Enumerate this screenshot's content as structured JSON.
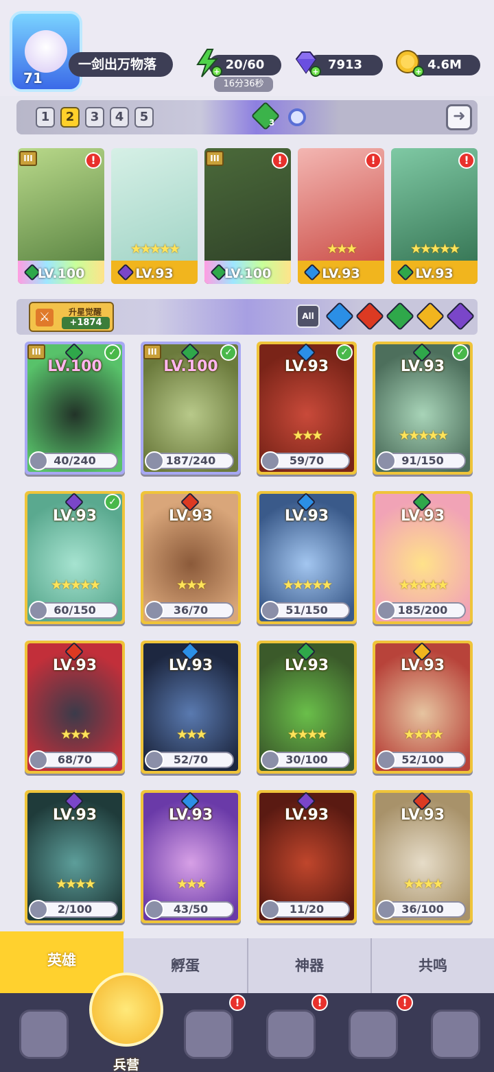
{
  "player": {
    "level": "71",
    "name": "一剑出万物落"
  },
  "resources": {
    "energy": "20/60",
    "energy_timer": "16分36秒",
    "diamonds": "7913",
    "gold": "4.6M"
  },
  "team_tabs": [
    "1",
    "2",
    "3",
    "4",
    "5"
  ],
  "active_team": "2",
  "green_gem_count": "3",
  "team": [
    {
      "level": "LV.100",
      "stars": "",
      "element": "green",
      "bar": "rainbow",
      "tier": "III",
      "alert": "!"
    },
    {
      "level": "LV.93",
      "stars": "★★★★★",
      "element": "purple",
      "bar": "gold",
      "tier": "",
      "alert": ""
    },
    {
      "level": "LV.100",
      "stars": "",
      "element": "green",
      "bar": "rainbow",
      "tier": "III",
      "alert": "!"
    },
    {
      "level": "LV.93",
      "stars": "★★★",
      "element": "blue",
      "bar": "gold",
      "tier": "",
      "alert": "!"
    },
    {
      "level": "LV.93",
      "stars": "★★★★★",
      "element": "green",
      "bar": "gold",
      "tier": "",
      "alert": "!"
    }
  ],
  "upgrade": {
    "title": "升星觉醒",
    "value": "+1874"
  },
  "filters": {
    "all_label": "All",
    "elements": [
      "blue",
      "red",
      "green",
      "yellow",
      "purple"
    ]
  },
  "heroes": [
    {
      "level": "LV.100",
      "element": "green",
      "stars": "",
      "shards": "40/240",
      "checked": true,
      "tier": "III",
      "frame": "top"
    },
    {
      "level": "LV.100",
      "element": "green",
      "stars": "",
      "shards": "187/240",
      "checked": true,
      "tier": "III",
      "frame": "top"
    },
    {
      "level": "LV.93",
      "element": "blue",
      "stars": "★★★",
      "shards": "59/70",
      "checked": true,
      "tier": "",
      "frame": "gold"
    },
    {
      "level": "LV.93",
      "element": "green",
      "stars": "★★★★★",
      "shards": "91/150",
      "checked": true,
      "tier": "",
      "frame": "gold"
    },
    {
      "level": "LV.93",
      "element": "purple",
      "stars": "★★★★★",
      "shards": "60/150",
      "checked": true,
      "tier": "",
      "frame": "gold"
    },
    {
      "level": "LV.93",
      "element": "red",
      "stars": "★★★",
      "shards": "36/70",
      "checked": false,
      "tier": "",
      "frame": "gold"
    },
    {
      "level": "LV.93",
      "element": "blue",
      "stars": "★★★★★",
      "shards": "51/150",
      "checked": false,
      "tier": "",
      "frame": "gold"
    },
    {
      "level": "LV.93",
      "element": "green",
      "stars": "★★★★★",
      "shards": "185/200",
      "checked": false,
      "tier": "",
      "frame": "gold"
    },
    {
      "level": "LV.93",
      "element": "red",
      "stars": "★★★",
      "shards": "68/70",
      "checked": false,
      "tier": "",
      "frame": "gold"
    },
    {
      "level": "LV.93",
      "element": "blue",
      "stars": "★★★",
      "shards": "52/70",
      "checked": false,
      "tier": "",
      "frame": "gold"
    },
    {
      "level": "LV.93",
      "element": "green",
      "stars": "★★★★",
      "shards": "30/100",
      "checked": false,
      "tier": "",
      "frame": "gold"
    },
    {
      "level": "LV.93",
      "element": "yellow",
      "stars": "★★★★",
      "shards": "52/100",
      "checked": false,
      "tier": "",
      "frame": "gold"
    },
    {
      "level": "LV.93",
      "element": "purple",
      "stars": "★★★★",
      "shards": "2/100",
      "checked": false,
      "tier": "",
      "frame": "gold"
    },
    {
      "level": "LV.93",
      "element": "blue",
      "stars": "★★★",
      "shards": "43/50",
      "checked": false,
      "tier": "",
      "frame": "gold"
    },
    {
      "level": "LV.93",
      "element": "purple",
      "stars": "",
      "shards": "11/20",
      "checked": false,
      "tier": "",
      "frame": "gold"
    },
    {
      "level": "LV.93",
      "element": "red",
      "stars": "★★★★",
      "shards": "36/100",
      "checked": false,
      "tier": "",
      "frame": "gold"
    }
  ],
  "subtabs": [
    "英雄",
    "孵蛋",
    "神器",
    "共鸣"
  ],
  "nav": {
    "active_label": "兵营",
    "alert": "!"
  },
  "colors": {
    "green": "#2fa84a",
    "purple": "#7a46c9",
    "blue": "#2b8fe6",
    "red": "#dc3a22",
    "yellow": "#f1b51e"
  }
}
